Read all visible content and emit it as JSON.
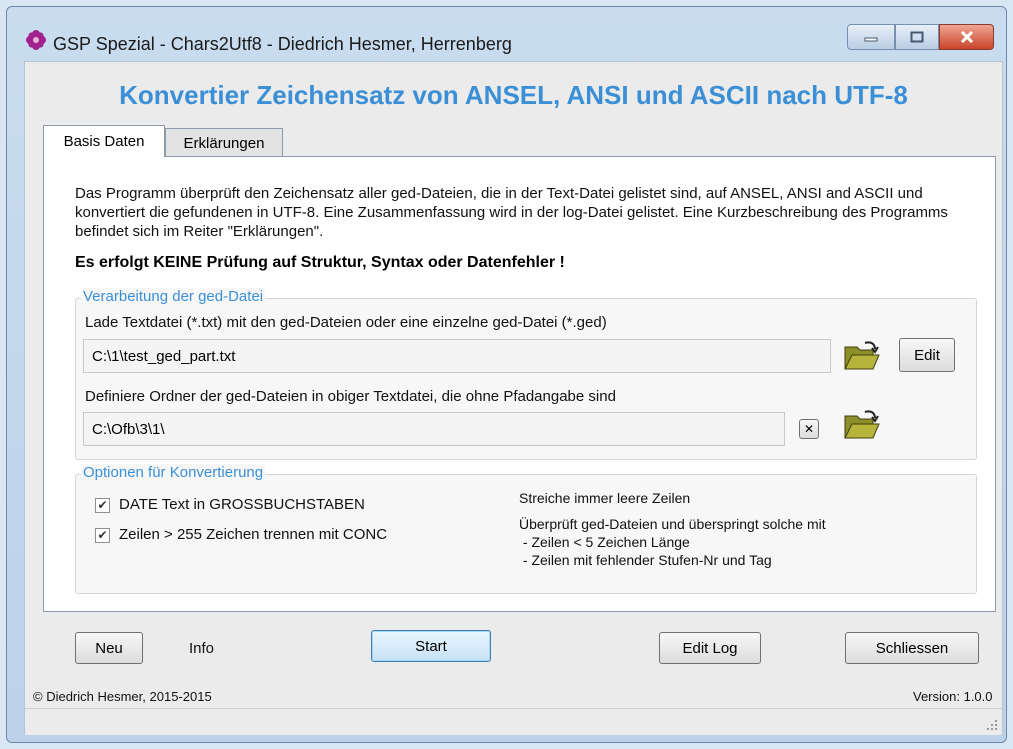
{
  "window": {
    "title": "GSP Spezial - Chars2Utf8  -  Diedrich Hesmer, Herrenberg"
  },
  "header": {
    "title": "Konvertier Zeichensatz von ANSEL, ANSI und ASCII nach UTF-8"
  },
  "tabs": [
    {
      "label": "Basis Daten",
      "active": true
    },
    {
      "label": "Erklärungen",
      "active": false
    }
  ],
  "panel": {
    "description": "Das Programm überprüft den Zeichensatz aller ged-Dateien, die in der Text-Datei gelistet sind, auf ANSEL, ANSI and ASCII und konvertiert die gefundenen in UTF-8. Eine Zusammenfassung wird in der log-Datei gelistet. Eine Kurzbeschreibung des Programms befindet sich im Reiter \"Erklärungen\".",
    "warning": "Es erfolgt KEINE Prüfung auf Struktur, Syntax oder Datenfehler !"
  },
  "processing": {
    "title": "Verarbeitung der ged-Datei",
    "load_label": "Lade Textdatei (*.txt) mit den ged-Dateien oder eine einzelne ged-Datei (*.ged)",
    "load_value": "C:\\1\\test_ged_part.txt",
    "edit_label": "Edit",
    "folder_label": "Definiere Ordner der ged-Dateien in obiger Textdatei, die ohne Pfadangabe sind",
    "folder_value": "C:\\Ofb\\3\\1\\",
    "clear_symbol": "✕"
  },
  "options": {
    "title": "Optionen für Konvertierung",
    "date_upper": {
      "label": "DATE Text in GROSSBUCHSTABEN",
      "checked": true
    },
    "split_lines": {
      "label": "Zeilen > 255 Zeichen trennen mit CONC",
      "checked": true
    },
    "info_line1": "Streiche immer leere Zeilen",
    "info_line2": "Überprüft ged-Dateien und überspringt solche mit",
    "info_line3": " - Zeilen < 5 Zeichen Länge",
    "info_line4": " - Zeilen mit fehlender Stufen-Nr und Tag"
  },
  "buttons": {
    "new": "Neu",
    "info": "Info",
    "start": "Start",
    "edit_log": "Edit Log",
    "close": "Schliessen"
  },
  "footer": {
    "copyright": "© Diedrich Hesmer, 2015-2015",
    "version": "Version: 1.0.0"
  },
  "colors": {
    "accent": "#3b8fd6",
    "close_button": "#c9442a",
    "window_frame": "#c9dcef"
  }
}
